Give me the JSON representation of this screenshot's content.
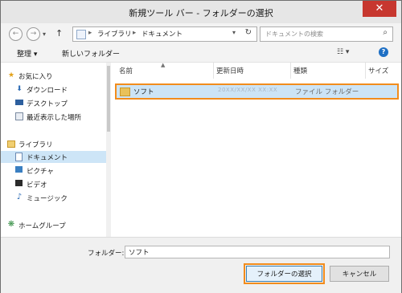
{
  "window": {
    "title": "新規ツール バー - フォルダーの選択",
    "close_label": "✕"
  },
  "nav": {
    "back_icon": "back-arrow",
    "forward_icon": "forward-arrow",
    "up_icon": "up-arrow",
    "address": {
      "segments": [
        "ライブラリ",
        "ドキュメント"
      ],
      "separator": "▸"
    },
    "search_placeholder": "ドキュメントの検索"
  },
  "toolbar": {
    "organize": "整理 ▾",
    "new_folder": "新しいフォルダー"
  },
  "sidebar": {
    "favorites_label": "お気に入り",
    "favorites": [
      "ダウンロード",
      "デスクトップ",
      "最近表示した場所"
    ],
    "libraries_label": "ライブラリ",
    "libraries": [
      "ドキュメント",
      "ピクチャ",
      "ビデオ",
      "ミュージック"
    ],
    "homegroup_label": "ホームグループ"
  },
  "columns": {
    "name": "名前",
    "date": "更新日時",
    "type": "種類",
    "size": "サイズ"
  },
  "files": [
    {
      "name": "ソフト",
      "date": "20XX/XX/XX XX:XX",
      "type": "ファイル フォルダー"
    }
  ],
  "footer": {
    "folder_label": "フォルダー:",
    "folder_value": "ソフト",
    "select_button": "フォルダーの選択",
    "cancel_button": "キャンセル"
  },
  "colors": {
    "selection": "#cce4f6",
    "highlight_box": "#f28c1c",
    "close": "#c7372f"
  }
}
